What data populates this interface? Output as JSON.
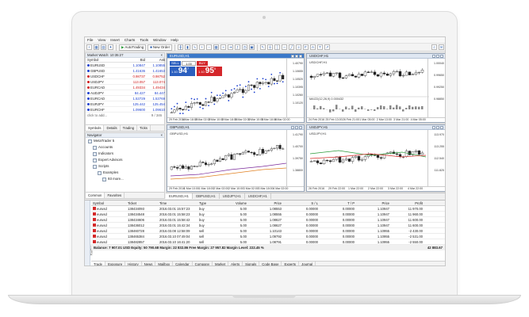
{
  "menu": [
    "File",
    "View",
    "Insert",
    "Charts",
    "Tools",
    "Window",
    "Help"
  ],
  "toolbar": {
    "autotrading_label": "AutoTrading",
    "new_order_label": "New Order"
  },
  "market_watch": {
    "title": "Market Watch: 10:35:27",
    "columns": [
      "Symbol",
      "Bid",
      "Ask"
    ],
    "rows": [
      {
        "symbol": "EURUSD",
        "bid": "1.10847",
        "ask": "1.10855",
        "dir": "up"
      },
      {
        "symbol": "GBPUSD",
        "bid": "1.41636",
        "ask": "1.41653",
        "dir": "up"
      },
      {
        "symbol": "USDCHF",
        "bid": "0.98737",
        "ask": "0.98752",
        "dir": "dn"
      },
      {
        "symbol": "USDJPY",
        "bid": "113.057",
        "ask": "113.074",
        "dir": "dn"
      },
      {
        "symbol": "EURCAD",
        "bid": "1.49334",
        "ask": "1.49434",
        "dir": "dn"
      },
      {
        "symbol": "AUDJPY",
        "bid": "84.427",
        "ask": "84.447",
        "dir": "up"
      },
      {
        "symbol": "EURCAD",
        "bid": "1.53729",
        "ask": "1.53769",
        "dir": "up"
      },
      {
        "symbol": "EURJPY",
        "bid": "125.442",
        "ask": "125.454",
        "dir": "up"
      },
      {
        "symbol": "EURCHF",
        "bid": "1.09600",
        "ask": "1.09610",
        "dir": "up"
      }
    ],
    "add_symbol": "click to add...",
    "count": "9 / 346",
    "tabs": [
      "Symbols",
      "Details",
      "Trading",
      "Ticks"
    ]
  },
  "navigator": {
    "title": "Navigator",
    "items": [
      {
        "label": "MetaTrader 5",
        "indent": 0
      },
      {
        "label": "Accounts",
        "indent": 1
      },
      {
        "label": "Indicators",
        "indent": 1
      },
      {
        "label": "Expert Advisors",
        "indent": 1
      },
      {
        "label": "Scripts",
        "indent": 1
      },
      {
        "label": "Examples",
        "indent": 2
      },
      {
        "label": "93 more...",
        "indent": 3
      }
    ],
    "tabs": [
      "Common",
      "Favorites"
    ]
  },
  "charts": {
    "eurusd": {
      "title": "EURUSD,H1",
      "label": "EURUSD,H1",
      "sell_label": "SELL",
      "buy_label": "BUY",
      "lot": "1.00",
      "sell_price_small": "1.10",
      "sell_price_big": "94",
      "sell_price_sup": "7",
      "buy_price_small": "1.10",
      "buy_price_big": "95",
      "buy_price_sup": "5",
      "scale": [
        "1.40790",
        "1.10655",
        "1.10520",
        "1.10395",
        "1.10260",
        "1.10120"
      ],
      "axis": [
        "29 Feb 2016",
        "1 Mar 18:00",
        "2 Mar 02:00",
        "2 Mar 10:00",
        "2 Mar 18:00",
        "3 Mar 02:00",
        "3 Mar 10:00",
        "3 Mar 18:00",
        "4 Mar 02:00"
      ]
    },
    "usdchf": {
      "title": "USDCHF,H1",
      "label": "USDCHF,H1",
      "sub_label": "MACD(12,26,9) 0.000432",
      "scale": [
        "1.00040",
        "0.99650",
        "0.99250",
        "0.98850"
      ],
      "axis": [
        "24 Feb 2016",
        "25 Feb 13:00",
        "26 Feb 21:00",
        "1 Mar 05:00",
        "2 Mar 13:00",
        "3 Mar 21:00",
        "4 Mar 05:00"
      ]
    },
    "gbpusd": {
      "title": "GBPUSD,H1",
      "label": "GBPUSD,H1",
      "scale": [
        "1.41790",
        "1.40700",
        "1.39750",
        "1.38800"
      ],
      "axis": [
        "29 Feb 2016",
        "1 Mar 10:00",
        "1 Mar 18:00",
        "2 Mar 02:00",
        "2 Mar 10:00",
        "3 Mar 02:00",
        "3 Mar 18:00",
        "4 Mar 02:00"
      ]
    },
    "usdjpy": {
      "title": "USDJPY,H1",
      "label": "USDJPY,H1",
      "scale": [
        "113.970",
        "113.255",
        "112.540",
        "111.825"
      ],
      "axis": [
        "26 Feb 2016",
        "29 Feb 22:00",
        "1 Mar 22:00",
        "2 Mar 22:00",
        "3 Mar 22:00",
        "4 Mar 22:00"
      ]
    },
    "tabs": [
      "EURUSD,H1",
      "GBPUSD,H1",
      "USDJPY,H1",
      "USDCHF,H1"
    ]
  },
  "terminal": {
    "side_label": "Toolbox",
    "columns": [
      "Symbol",
      "Ticket",
      "Time",
      "Type",
      "Volume",
      "Price",
      "S / L",
      "T / P",
      "Price",
      "Profit"
    ],
    "rows": [
      {
        "symbol": "eurusd",
        "ticket": "138434093",
        "time": "2016.03.01 15:57:23",
        "type": "buy",
        "volume": "5.00",
        "price": "1.08553",
        "sl": "0.00000",
        "tp": "0.00000",
        "cur": "1.10947",
        "profit": "11 970.00"
      },
      {
        "symbol": "eurusd",
        "ticket": "138434548",
        "time": "2016.03.01 15:58:23",
        "type": "buy",
        "volume": "5.00",
        "price": "1.08555",
        "sl": "0.00000",
        "tp": "0.00000",
        "cur": "1.10947",
        "profit": "11 960.00"
      },
      {
        "symbol": "eurusd",
        "ticket": "138434606",
        "time": "2016.03.01 15:58:42",
        "type": "buy",
        "volume": "5.00",
        "price": "1.08627",
        "sl": "0.00000",
        "tp": "0.00000",
        "cur": "1.10947",
        "profit": "11 600.00"
      },
      {
        "symbol": "eurusd",
        "ticket": "138436012",
        "time": "2016.03.01 15:42:34",
        "type": "buy",
        "volume": "5.00",
        "price": "1.08627",
        "sl": "0.00000",
        "tp": "0.00000",
        "cur": "1.10947",
        "profit": "11 600.00"
      },
      {
        "symbol": "eurusd",
        "ticket": "138460728",
        "time": "2016.03.08 12:58:09",
        "type": "sell",
        "volume": "5.00",
        "price": "1.10143",
        "sl": "0.00000",
        "tp": "0.00000",
        "cur": "1.10955",
        "profit": "-2 430.00"
      },
      {
        "symbol": "eurusd",
        "ticket": "138465384",
        "time": "2016.03.10 07:49:04",
        "type": "sell",
        "volume": "5.00",
        "price": "1.09792",
        "sl": "0.00000",
        "tp": "0.00000",
        "cur": "1.10955",
        "profit": "-2 531.00"
      },
      {
        "symbol": "eurusd",
        "ticket": "138482857",
        "time": "2016.03.10 16:41:20",
        "type": "sell",
        "volume": "5.00",
        "price": "1.08791",
        "sl": "0.00000",
        "tp": "0.00000",
        "cur": "1.10955",
        "profit": "-2 550.00"
      }
    ],
    "balance_text": "Balance: 7 907.01 USD  Equity: 50 790.68  Margin: 22 832.86  Free Margin: 27 957.82  Margin Level: 222.45 %",
    "total_profit": "42 883.67",
    "tabs": [
      "Trade",
      "Exposure",
      "History",
      "News",
      "Mailbox",
      "Calendar",
      "Company",
      "Market",
      "Alerts",
      "Signals",
      "Code Base",
      "Experts",
      "Journal"
    ]
  },
  "colors": {
    "up": "#1a3fcf",
    "down": "#cf1a1a",
    "active_title": "#3a78c9"
  }
}
